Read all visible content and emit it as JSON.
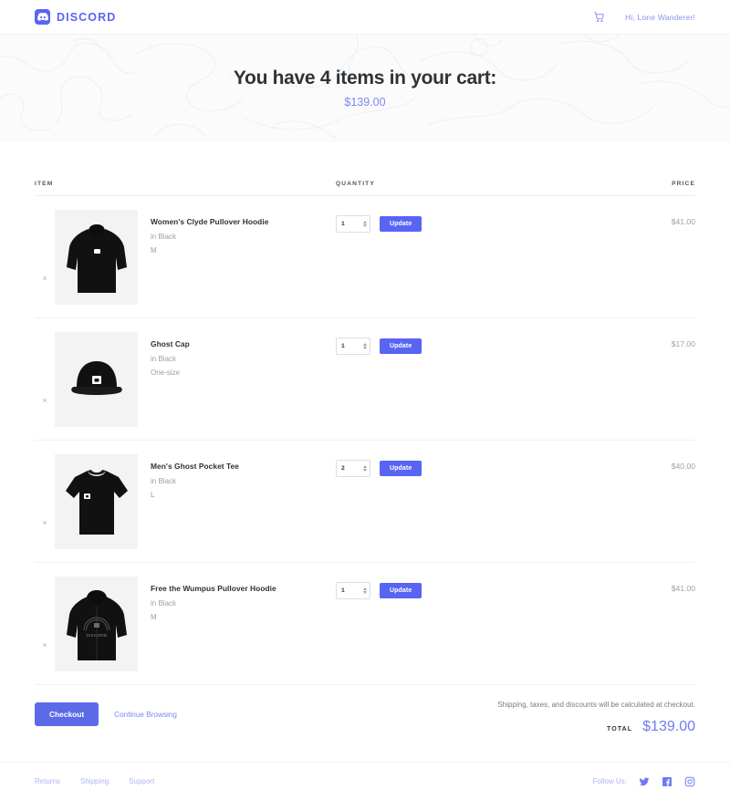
{
  "header": {
    "brand_name": "DISCORD",
    "brand_icon": "discord-logo-icon",
    "cart_icon": "shopping-cart-icon",
    "greeting": "Hi, Lone Wanderer!"
  },
  "hero": {
    "title": "You have 4 items in your cart:",
    "subtotal": "$139.00"
  },
  "table": {
    "columns": [
      "ITEM",
      "QUANTITY",
      "PRICE"
    ]
  },
  "items": [
    {
      "remove_label": "×",
      "image": "black-pullover-hoodie",
      "title": "Women's Clyde Pullover Hoodie",
      "color": "in Black",
      "size": "M",
      "quantity": "1",
      "update_label": "Update",
      "price": "$41.00"
    },
    {
      "remove_label": "×",
      "image": "black-cap",
      "title": "Ghost Cap",
      "color": "in Black",
      "size": "One-size",
      "quantity": "1",
      "update_label": "Update",
      "price": "$17.00"
    },
    {
      "remove_label": "×",
      "image": "black-tee",
      "title": "Men's Ghost Pocket Tee",
      "color": "in Black",
      "size": "L",
      "quantity": "2",
      "update_label": "Update",
      "price": "$40.00"
    },
    {
      "remove_label": "×",
      "image": "black-zip-hoodie",
      "title": "Free the Wumpus Pullover Hoodie",
      "color": "in Black",
      "size": "M",
      "quantity": "1",
      "update_label": "Update",
      "price": "$41.00"
    }
  ],
  "checkout": {
    "checkout_label": "Checkout",
    "continue_label": "Continue Browsing",
    "note": "Shipping, taxes, and discounts will be calculated at checkout.",
    "total_label": "TOTAL",
    "total_value": "$139.00"
  },
  "footer": {
    "links": [
      "Returns",
      "Shipping",
      "Support"
    ],
    "follow_label": "Follow Us:",
    "socials": [
      "twitter-icon",
      "facebook-icon",
      "instagram-icon"
    ]
  },
  "colors": {
    "blurple": "#5865f2",
    "light_blurple": "#7c86f3",
    "thumb_bg": "#f3f3f3",
    "hero_bg": "#fbfbfc"
  }
}
